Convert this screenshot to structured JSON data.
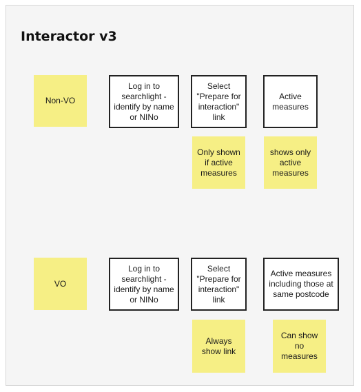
{
  "title": "Interactor v3",
  "rows": [
    {
      "label": "Non-VO",
      "steps": [
        "Log in to searchlight - identify by name or NINo",
        "Select \"Prepare for interaction\" link",
        "Active measures"
      ],
      "notes": [
        "Only shown if active measures",
        "shows only active measures"
      ]
    },
    {
      "label": "VO",
      "steps": [
        "Log in to searchlight - identify by name or NINo",
        "Select \"Prepare for interaction\" link",
        "Active measures including those at same postcode"
      ],
      "notes": [
        "Always show link",
        "Can show no measures"
      ]
    }
  ],
  "colors": {
    "sticky": "#f6ef85",
    "box_border": "#222222",
    "frame": "#f5f5f5"
  }
}
